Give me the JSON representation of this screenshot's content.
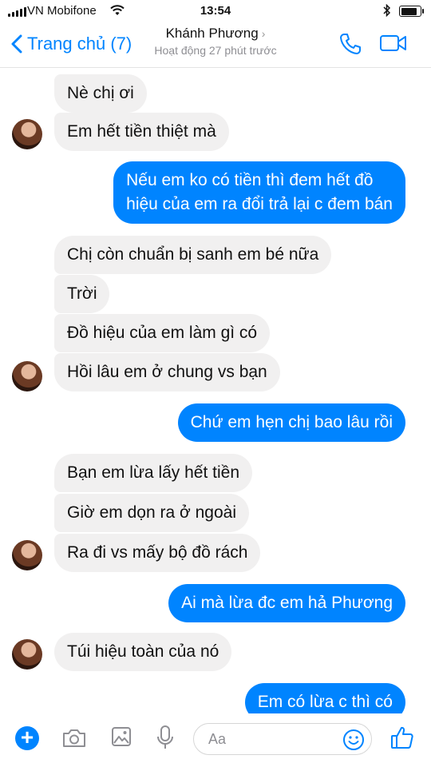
{
  "status_bar": {
    "carrier": "VN Mobifone",
    "time": "13:54",
    "battery_level": 0.85
  },
  "header": {
    "back_label": "Trang chủ (7)",
    "contact_name": "Khánh Phương",
    "contact_status": "Hoạt động 27 phút trước"
  },
  "messages": [
    {
      "from": "them",
      "text": "Nè chị ơi"
    },
    {
      "from": "them",
      "text": "Em hết tiền thiệt mà"
    },
    {
      "from": "me",
      "lines": [
        "Nếu em ko có tiền thì đem hết đồ",
        "hiệu của em ra đổi trả lại c đem bán"
      ]
    },
    {
      "from": "them",
      "text": "Chị còn chuẩn bị sanh em bé nữa"
    },
    {
      "from": "them",
      "text": "Trời"
    },
    {
      "from": "them",
      "text": "Đồ hiệu của em làm gì có"
    },
    {
      "from": "them",
      "text": "Hồi lâu em ở chung vs bạn"
    },
    {
      "from": "me",
      "text": "Chứ em hẹn chị bao lâu rồi"
    },
    {
      "from": "them",
      "text": "Bạn em lừa lấy hết tiền"
    },
    {
      "from": "them",
      "text": "Giờ em dọn ra ở ngoài"
    },
    {
      "from": "them",
      "text": "Ra đi vs mấy bộ đồ rách"
    },
    {
      "from": "me",
      "text": "Ai mà lừa đc em hả Phương"
    },
    {
      "from": "them",
      "text": "Túi hiệu toàn của nó"
    },
    {
      "from": "me",
      "text": "Em có lừa c thì có"
    }
  ],
  "composer": {
    "placeholder": "Aa",
    "value": ""
  },
  "colors": {
    "accent": "#0084ff",
    "incoming_bubble": "#f1f0f0",
    "outgoing_text": "#ffffff"
  }
}
